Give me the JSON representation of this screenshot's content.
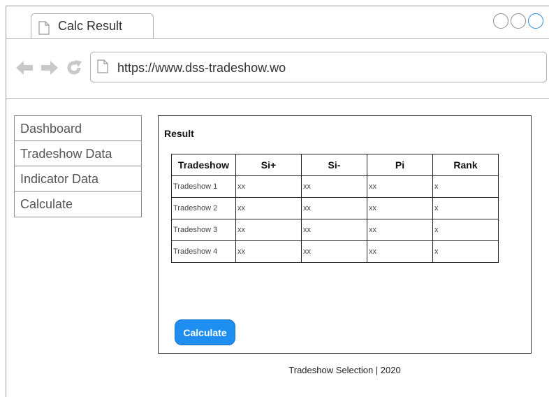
{
  "browser": {
    "tab_title": "Calc Result",
    "url": "https://www.dss-tradeshow.wo"
  },
  "sidebar": {
    "items": [
      {
        "label": "Dashboard"
      },
      {
        "label": "Tradeshow Data"
      },
      {
        "label": "Indicator Data"
      },
      {
        "label": "Calculate"
      }
    ]
  },
  "main": {
    "title": "Result",
    "table": {
      "headers": [
        "Tradeshow",
        "Si+",
        "Si-",
        "Pi",
        "Rank"
      ],
      "rows": [
        [
          "Tradeshow 1",
          "xx",
          "xx",
          "xx",
          "x"
        ],
        [
          "Tradeshow 2",
          "xx",
          "xx",
          "xx",
          "x"
        ],
        [
          "Tradeshow 3",
          "xx",
          "xx",
          "xx",
          "x"
        ],
        [
          "Tradeshow 4",
          "xx",
          "xx",
          "xx",
          "x"
        ]
      ]
    },
    "calculate_label": "Calculate"
  },
  "footer": {
    "text": "Tradeshow Selection | 2020"
  },
  "colors": {
    "accent": "#1e8ff0",
    "active_window_control": "#2b8de8"
  },
  "icons": [
    "document-icon",
    "back-arrow-icon",
    "forward-arrow-icon",
    "reload-icon"
  ]
}
